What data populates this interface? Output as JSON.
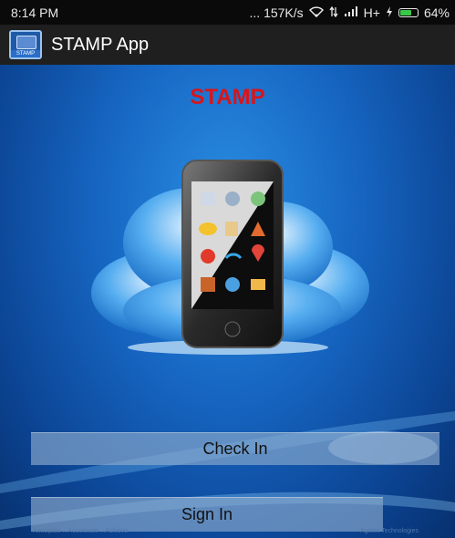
{
  "status_bar": {
    "time": "8:14 PM",
    "network_speed": "... 157K/s",
    "signal_text": "H+",
    "battery_text": "64%",
    "battery_level": 0.64,
    "icons": [
      "wifi-icon",
      "data-arrows-icon",
      "signal-icon",
      "charging-icon",
      "battery-icon"
    ]
  },
  "action_bar": {
    "app_title": "STAMP App",
    "app_icon_word": "STAMP"
  },
  "splash": {
    "title": "STAMP",
    "title_color": "#d8151c"
  },
  "buttons": {
    "check_in_label": "Check In",
    "sign_in_label": "Sign In"
  },
  "footer": {
    "left_text": "Anticipate ...Accelerate ...Achieve",
    "right_text": "Agilent Technologies"
  }
}
